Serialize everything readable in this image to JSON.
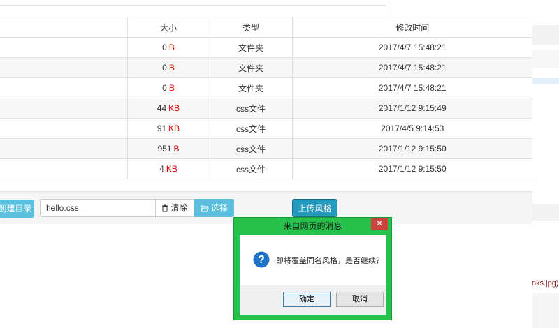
{
  "table": {
    "headers": [
      "",
      "大小",
      "类型",
      "修改时间"
    ],
    "rows": [
      {
        "size": "0",
        "unit": "B",
        "type": "文件夹",
        "modified": "2017/4/7 15:48:21"
      },
      {
        "size": "0",
        "unit": "B",
        "type": "文件夹",
        "modified": "2017/4/7 15:48:21"
      },
      {
        "size": "0",
        "unit": "B",
        "type": "文件夹",
        "modified": "2017/4/7 15:48:21"
      },
      {
        "size": "44",
        "unit": "KB",
        "type": "css文件",
        "modified": "2017/1/12 9:15:49"
      },
      {
        "size": "91",
        "unit": "KB",
        "type": "css文件",
        "modified": "2017/4/5 9:14:53"
      },
      {
        "size": "951",
        "unit": "B",
        "type": "css文件",
        "modified": "2017/1/12 9:15:50"
      },
      {
        "size": "4",
        "unit": "KB",
        "type": "css文件",
        "modified": "2017/1/12 9:15:50"
      }
    ]
  },
  "toolbar": {
    "mkdir_label": "创建目录",
    "filename_value": "hello.css",
    "clear_label": "清除",
    "select_label": "选择",
    "upload_label": "上传风格"
  },
  "dialog": {
    "title": "来自网页的消息",
    "message": "即将覆盖同名风格，是否继续？",
    "ok_label": "确定",
    "cancel_label": "取消"
  },
  "side": {
    "code_fragment": "nks.jpg);"
  },
  "colors": {
    "accent": "#5bc0de",
    "upload": "#269abc",
    "unit_red": "#e60000",
    "dialog_frame": "#27c24c"
  },
  "icons": {
    "trash": "trash-icon",
    "folder_open": "folder-open-icon",
    "question": "question-icon",
    "close": "close-icon"
  }
}
